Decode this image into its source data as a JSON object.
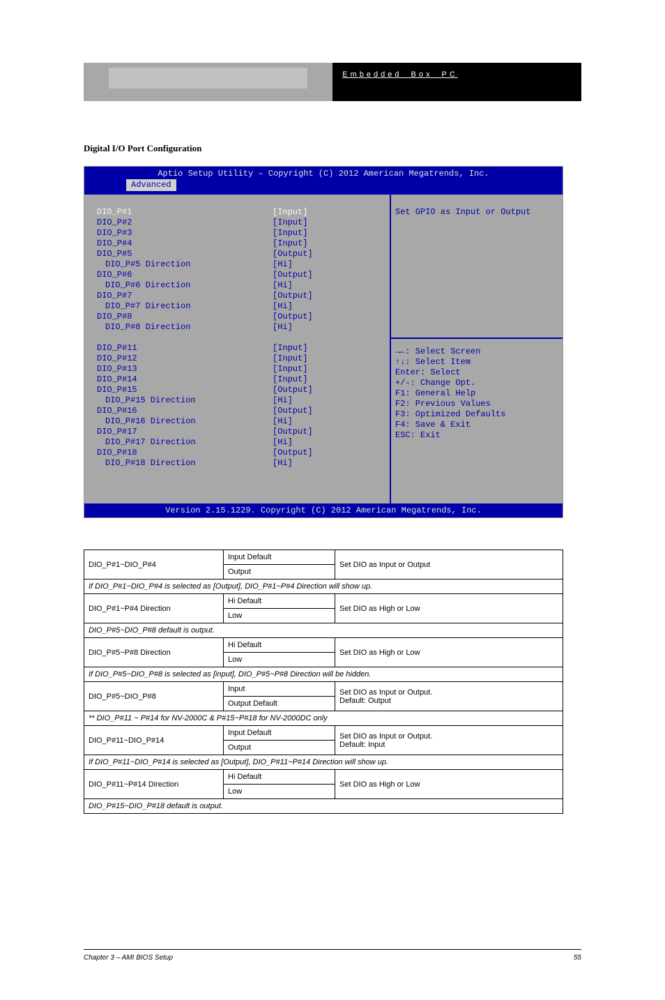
{
  "header": {
    "black_text": "Embedded Box PC"
  },
  "section_heading": "Digital I/O Port Configuration",
  "bios": {
    "title": "Aptio Setup Utility – Copyright (C) 2012 American Megatrends, Inc.",
    "tab": "Advanced",
    "bottom": "Version 2.15.1229. Copyright (C) 2012 American Megatrends, Inc.",
    "help": "Set GPIO as Input or Output",
    "items": [
      {
        "label": "DIO_P#1",
        "value": "[Input]",
        "selected": true
      },
      {
        "label": "DIO_P#2",
        "value": "[Input]"
      },
      {
        "label": "DIO_P#3",
        "value": "[Input]"
      },
      {
        "label": "DIO_P#4",
        "value": "[Input]"
      },
      {
        "label": "DIO_P#5",
        "value": "[Output]"
      },
      {
        "label": "DIO_P#5 Direction",
        "value": "[Hi]",
        "indent": true
      },
      {
        "label": "DIO_P#6",
        "value": "[Output]"
      },
      {
        "label": "DIO_P#6 Direction",
        "value": "[Hi]",
        "indent": true
      },
      {
        "label": "DIO_P#7",
        "value": "[Output]"
      },
      {
        "label": "DIO_P#7 Direction",
        "value": "[Hi]",
        "indent": true
      },
      {
        "label": "DIO_P#8",
        "value": "[Output]"
      },
      {
        "label": "DIO_P#8 Direction",
        "value": "[Hi]",
        "indent": true
      },
      {
        "spacer": true
      },
      {
        "label": "DIO_P#11",
        "value": "[Input]"
      },
      {
        "label": "DIO_P#12",
        "value": "[Input]"
      },
      {
        "label": "DIO_P#13",
        "value": "[Input]"
      },
      {
        "label": "DIO_P#14",
        "value": "[Input]"
      },
      {
        "label": "DIO_P#15",
        "value": "[Output]"
      },
      {
        "label": "DIO_P#15 Direction",
        "value": "[Hi]",
        "indent": true
      },
      {
        "label": "DIO_P#16",
        "value": "[Output]"
      },
      {
        "label": "DIO_P#16 Direction",
        "value": "[Hi]",
        "indent": true
      },
      {
        "label": "DIO_P#17",
        "value": "[Output]"
      },
      {
        "label": "DIO_P#17 Direction",
        "value": "[Hi]",
        "indent": true
      },
      {
        "label": "DIO_P#18",
        "value": "[Output]"
      },
      {
        "label": "DIO_P#18 Direction",
        "value": "[Hi]",
        "indent": true
      }
    ],
    "keys": [
      "→←: Select Screen",
      "↑↓: Select Item",
      "Enter: Select",
      "+/-: Change Opt.",
      "F1: General Help",
      "F2: Previous Values",
      "F3: Optimized Defaults",
      "F4: Save & Exit",
      "ESC: Exit"
    ]
  },
  "table": [
    {
      "type": "item",
      "name": "DIO_P#1~DIO_P#4",
      "options": [
        "Input",
        "Output"
      ],
      "default_idx": 0,
      "desc": "Set DIO as Input or Output"
    },
    {
      "type": "cond",
      "text": "If DIO_P#1~DIO_P#4 is selected as [Output], DIO_P#1~P#4 Direction will show up."
    },
    {
      "type": "item",
      "name": "DIO_P#1~P#4 Direction",
      "options": [
        "Hi",
        "Low"
      ],
      "default_idx": 0,
      "desc": "Set DIO as High or Low"
    },
    {
      "type": "cond",
      "text": "DIO_P#5~DIO_P#8 default is output."
    },
    {
      "type": "item",
      "name": "DIO_P#5~P#8 Direction",
      "options": [
        "Hi",
        "Low"
      ],
      "default_idx": 0,
      "desc": "Set DIO as High or Low"
    },
    {
      "type": "cond",
      "text": "If DIO_P#5~DIO_P#8 is selected as [input], DIO_P#5~P#8 Direction will be hidden."
    },
    {
      "type": "item",
      "name": "DIO_P#5~DIO_P#8",
      "options": [
        "Input",
        "Output"
      ],
      "default_idx": 1,
      "desc": [
        "Set DIO as Input or Output.",
        "Default: Output"
      ]
    },
    {
      "type": "cond",
      "text": "** DIO_P#11 ~ P#14 for NV-2000C & P#15~P#18 for NV-2000DC only"
    },
    {
      "type": "item",
      "name": "DIO_P#11~DIO_P#14",
      "options": [
        "Input",
        "Output"
      ],
      "default_idx": 0,
      "desc": [
        "Set DIO as Input or Output.",
        "Default: Input"
      ]
    },
    {
      "type": "cond",
      "text": "If DIO_P#11~DIO_P#14 is selected as [Output], DIO_P#11~P#14 Direction will show up."
    },
    {
      "type": "item",
      "name": "DIO_P#11~P#14 Direction",
      "options": [
        "Hi",
        "Low"
      ],
      "default_idx": 0,
      "desc": "Set DIO as High or Low"
    },
    {
      "type": "cond",
      "text": "DIO_P#15~DIO_P#18 default is output."
    }
  ],
  "footer": {
    "left": "Chapter 3 – AMI BIOS Setup",
    "right": "55"
  }
}
